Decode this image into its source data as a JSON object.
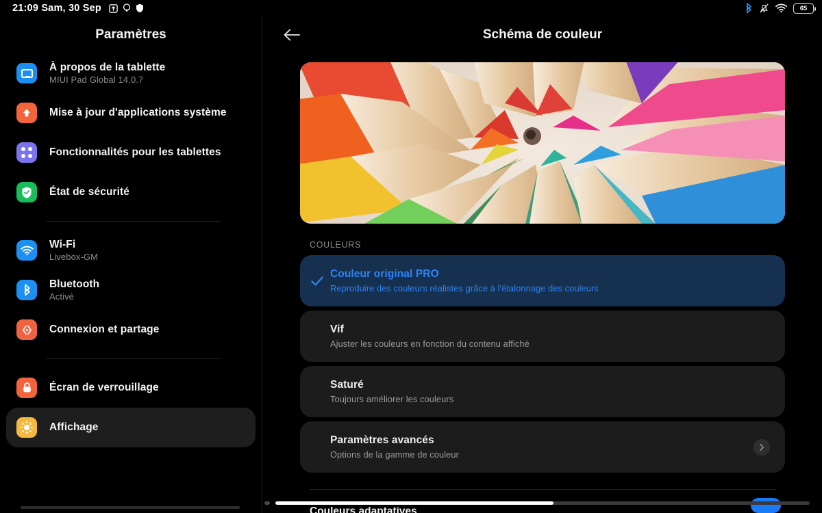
{
  "statusbar": {
    "clock": "21:09 Sam, 30 Sep",
    "left_icons": [
      "upload-box-icon",
      "location-icon",
      "shield-icon"
    ],
    "right_icons": [
      "bluetooth-icon",
      "notifications-muted-icon",
      "wifi-icon"
    ],
    "battery_level": "65",
    "bluetooth_color": "#2f9bf5"
  },
  "sidebar": {
    "title": "Paramètres",
    "groups": [
      {
        "items": [
          {
            "label": "À propos de la tablette",
            "sub": "MIUI Pad Global 14.0.7",
            "icon": "tablet-icon",
            "color": "#1b90f2",
            "selected": false
          },
          {
            "label": "Mise à jour d'applications système",
            "sub": "",
            "icon": "update-arrow-icon",
            "color": "#f2643c",
            "selected": false
          },
          {
            "label": "Fonctionnalités pour les tablettes",
            "sub": "",
            "icon": "four-dots-icon",
            "color": "#7b74ee",
            "selected": false
          },
          {
            "label": "État de sécurité",
            "sub": "",
            "icon": "shield-check-icon",
            "color": "#17bd5a",
            "selected": false
          }
        ]
      },
      {
        "items": [
          {
            "label": "Wi-Fi",
            "sub": "Livebox-GM",
            "icon": "wifi-icon",
            "color": "#1b90f2",
            "selected": false
          },
          {
            "label": "Bluetooth",
            "sub": "Activé",
            "icon": "bluetooth-icon",
            "color": "#1b90f2",
            "selected": false
          },
          {
            "label": "Connexion et partage",
            "sub": "",
            "icon": "connection-share-icon",
            "color": "#ef6341",
            "selected": false
          }
        ]
      },
      {
        "items": [
          {
            "label": "Écran de verrouillage",
            "sub": "",
            "icon": "lock-icon",
            "color": "#f2643c",
            "selected": false
          },
          {
            "label": "Affichage",
            "sub": "",
            "icon": "brightness-sun-icon",
            "color": "#f5b942",
            "selected": true
          }
        ]
      }
    ]
  },
  "main": {
    "back_icon": "back-arrow-icon",
    "title": "Schéma de couleur",
    "hero_image": "colored-pencils-photo",
    "section_label": "COULEURS",
    "options": [
      {
        "title": "Couleur original PRO",
        "sub": "Reproduire des couleurs réalistes grâce à l'étalonnage des couleurs",
        "selected": true,
        "chevron": false
      },
      {
        "title": "Vif",
        "sub": "Ajuster les couleurs en fonction du contenu affiché",
        "selected": false,
        "chevron": false
      },
      {
        "title": "Saturé",
        "sub": "Toujours améliorer les couleurs",
        "selected": false,
        "chevron": false
      },
      {
        "title": "Paramètres avancés",
        "sub": "Options de la gamme de couleur",
        "selected": false,
        "chevron": true
      }
    ],
    "bottom_partial": {
      "label": "Couleurs adaptatives",
      "toggle_on": true,
      "toggle_color": "#1b7af5"
    }
  },
  "colors": {
    "background": "#000000",
    "card": "#1c1c1c",
    "card_selected": "#16314f",
    "accent_blue": "#2f83f7",
    "sidebar_selected": "#1e1e1e"
  }
}
